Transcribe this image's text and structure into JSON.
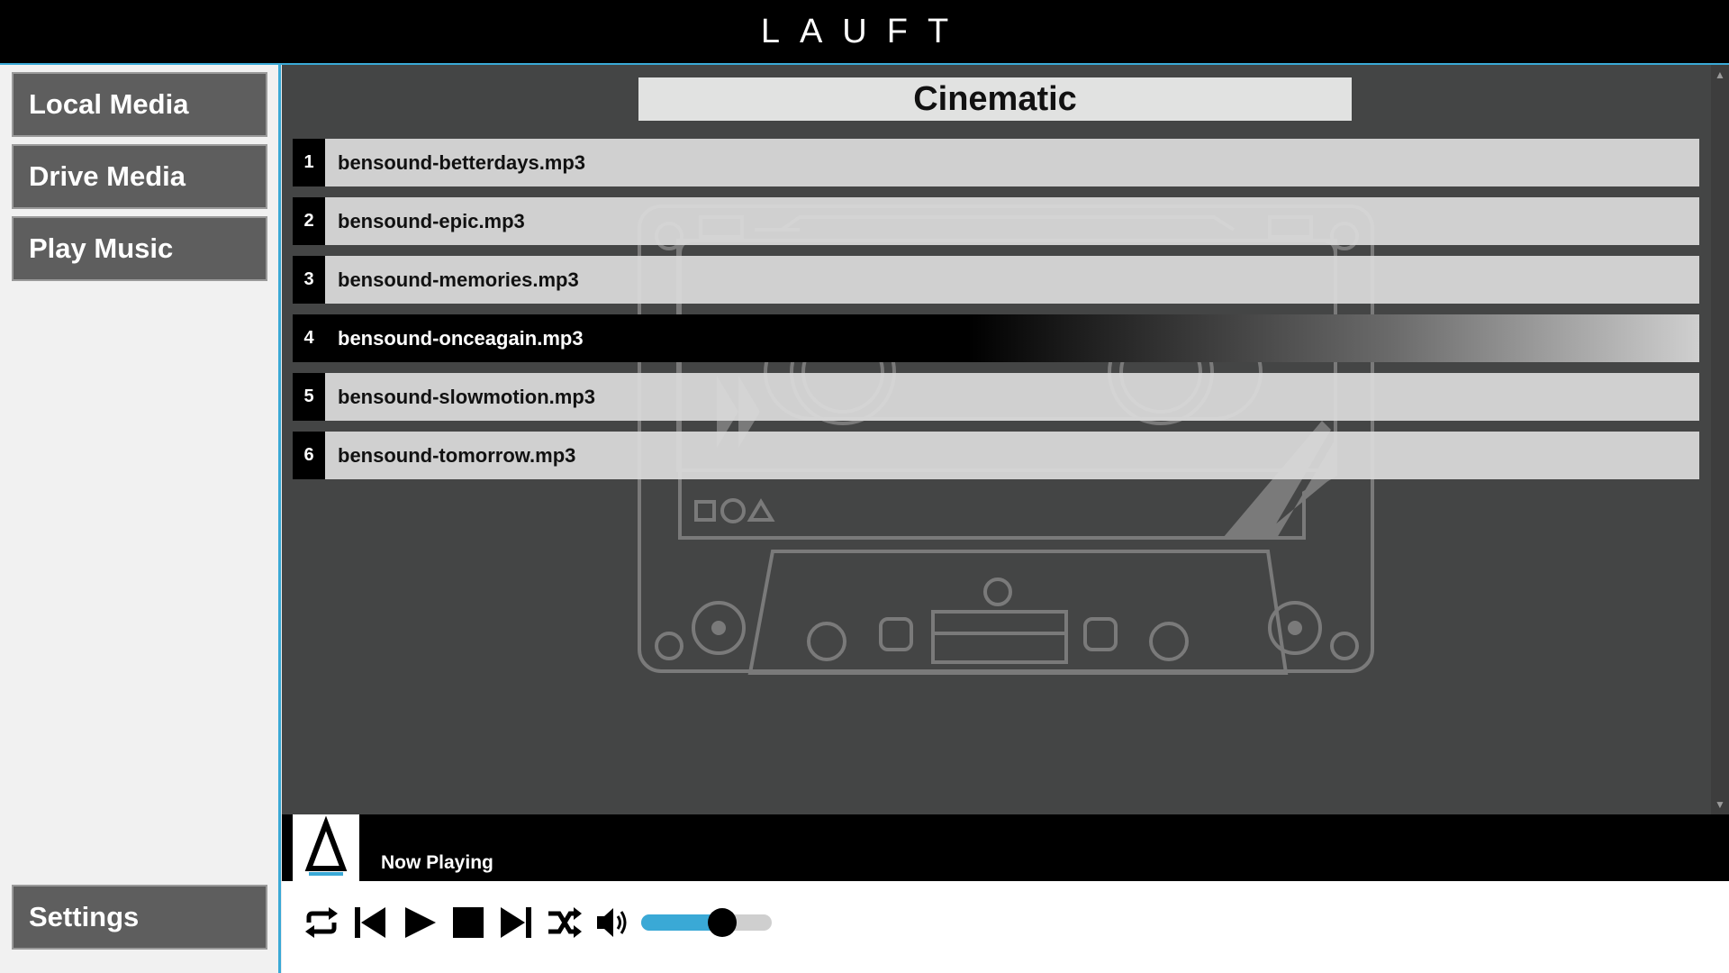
{
  "app": {
    "logo_text": "LAUFT"
  },
  "sidebar": {
    "items": [
      {
        "label": "Local Media"
      },
      {
        "label": "Drive Media"
      },
      {
        "label": "Play Music"
      }
    ],
    "settings_label": "Settings"
  },
  "playlist": {
    "title": "Cinematic",
    "tracks": [
      {
        "number": "1",
        "name": "bensound-betterdays.mp3"
      },
      {
        "number": "2",
        "name": "bensound-epic.mp3"
      },
      {
        "number": "3",
        "name": "bensound-memories.mp3"
      },
      {
        "number": "4",
        "name": "bensound-onceagain.mp3",
        "active": true
      },
      {
        "number": "5",
        "name": "bensound-slowmotion.mp3"
      },
      {
        "number": "6",
        "name": "bensound-tomorrow.mp3"
      }
    ]
  },
  "player": {
    "now_playing_label": "Now Playing",
    "volume_fraction": 0.62,
    "icons": [
      "repeat-icon",
      "previous-icon",
      "play-icon",
      "stop-icon",
      "next-icon",
      "shuffle-icon",
      "volume-icon"
    ]
  },
  "colors": {
    "accent": "#3aa9d6",
    "panel": "#444545",
    "sidebar_button": "#5e5e5e"
  }
}
